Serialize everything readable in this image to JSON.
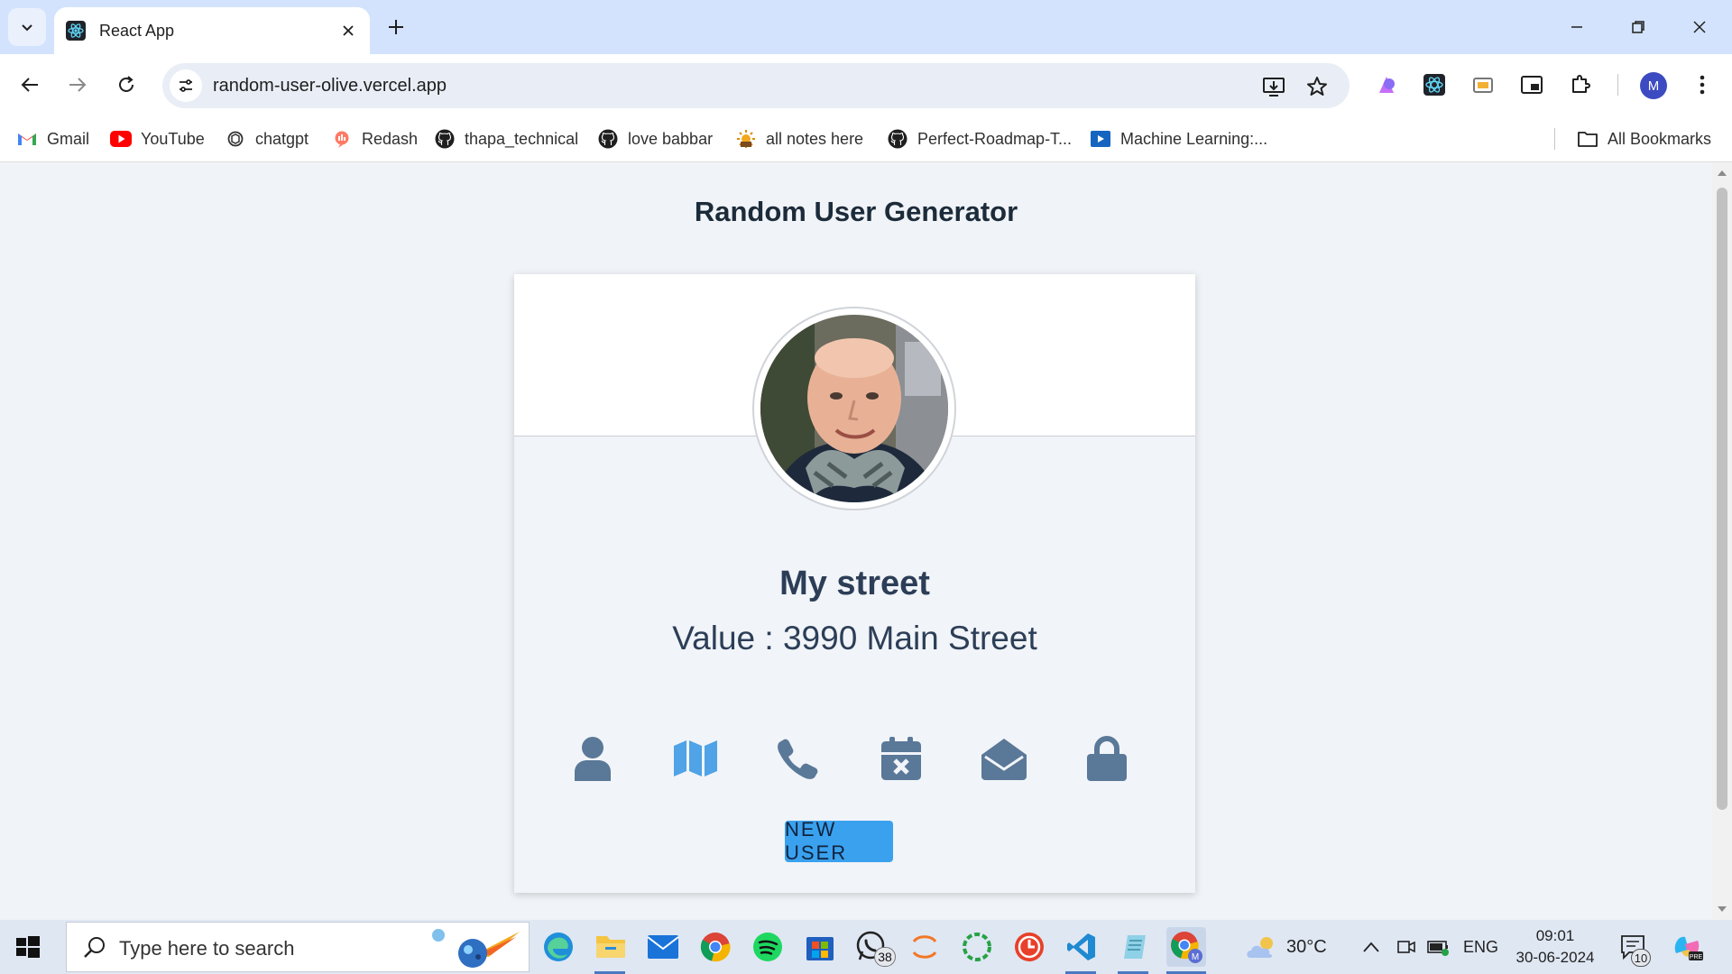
{
  "browser": {
    "tab_title": "React App",
    "url": "random-user-olive.vercel.app",
    "profile_initial": "M"
  },
  "bookmarks": [
    {
      "label": "Gmail",
      "icon": "gmail-icon"
    },
    {
      "label": "YouTube",
      "icon": "youtube-icon"
    },
    {
      "label": "chatgpt",
      "icon": "chatgpt-icon"
    },
    {
      "label": "Redash",
      "icon": "redash-icon"
    },
    {
      "label": "thapa_technical",
      "icon": "github-icon"
    },
    {
      "label": "love babbar",
      "icon": "github-icon"
    },
    {
      "label": "all notes here",
      "icon": "notes-icon"
    },
    {
      "label": "Perfect-Roadmap-T...",
      "icon": "github-icon"
    },
    {
      "label": "Machine Learning:...",
      "icon": "video-icon"
    },
    {
      "label": "All Bookmarks",
      "icon": "folder-icon"
    }
  ],
  "page": {
    "title": "Random User Generator",
    "info_title": "My street",
    "info_value": "Value : 3990 Main Street",
    "button_label": "NEW USER",
    "icons": [
      "user-icon",
      "map-icon",
      "phone-icon",
      "calendar-icon",
      "envelope-open-icon",
      "lock-icon"
    ]
  },
  "taskbar": {
    "search_placeholder": "Type here to search",
    "whatsapp_badge": "38",
    "weather": "30°C",
    "language": "ENG",
    "time": "09:01",
    "date": "30-06-2024",
    "notification_count": "10"
  },
  "colors": {
    "page_bg": "#f0f3f7",
    "icon_color": "#5a7898",
    "accent": "#3aa1ee",
    "title_text": "#1c2b3a"
  }
}
